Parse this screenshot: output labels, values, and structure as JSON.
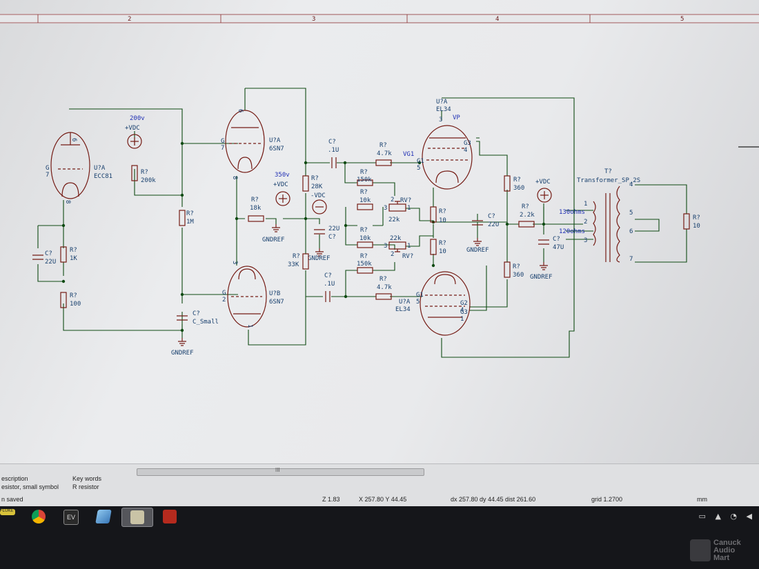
{
  "ruler": {
    "zones": [
      "2",
      "3",
      "4",
      "5"
    ]
  },
  "schematic": {
    "tubes": [
      {
        "ref": "U?A",
        "value": "ECC81",
        "pins": {
          "plate": "6",
          "grid": "G\n7",
          "cathode": "8"
        }
      },
      {
        "ref": "U?A",
        "value": "6SN7",
        "pins": {
          "plate": "6",
          "grid": "G\n7",
          "cathode": "8"
        }
      },
      {
        "ref": "U?B",
        "value": "6SN7",
        "pins": {
          "plate": "3",
          "grid": "G\n2",
          "cathode": "1"
        }
      },
      {
        "ref": "U?A",
        "value": "EL34",
        "pins": {
          "g1": "G1\n5",
          "g3": "G3\n4",
          "plate": "3"
        }
      },
      {
        "ref": "U?A",
        "value": "EL34",
        "pins": {
          "g1": "G1\n5",
          "g2": "G2\n4",
          "g3": "G3\n1"
        }
      }
    ],
    "labels": {
      "v200": "200v",
      "vdc1": "+VDC",
      "v350": "350v",
      "vdc2": "+VDC",
      "nvdc": "-VDC",
      "vdc3": "+VDC",
      "vg1": "VG1",
      "vp": "VP",
      "ohm130": "130ohms",
      "ohm120": "120ohms",
      "gnd1": "GNDREF",
      "gnd2": "GNDREF",
      "gnd3": "GNDREF",
      "gnd4": "GNDREF",
      "gnd5": "GNDREF",
      "transformer_ref": "T?",
      "transformer": "Transformer_SP_2S",
      "t_pins": [
        "1",
        "2",
        "3",
        "4",
        "5",
        "6",
        "7"
      ]
    },
    "components": [
      {
        "ref": "R?",
        "value": "200k"
      },
      {
        "ref": "R?",
        "value": "1M"
      },
      {
        "ref": "C?",
        "value": "C_Small"
      },
      {
        "ref": "C?",
        "value": "22U"
      },
      {
        "ref": "R?",
        "value": "1K"
      },
      {
        "ref": "R?",
        "value": "100"
      },
      {
        "ref": "R?",
        "value": "18k"
      },
      {
        "ref": "R?",
        "value": "28K"
      },
      {
        "ref": "R?",
        "value": "33K"
      },
      {
        "ref": "C?",
        "value": "22U"
      },
      {
        "ref": "C?",
        "value": ".1U"
      },
      {
        "ref": "C?",
        "value": ".1U"
      },
      {
        "ref": "R?",
        "value": "4.7k"
      },
      {
        "ref": "R?",
        "value": "150k"
      },
      {
        "ref": "R?",
        "value": "10k"
      },
      {
        "ref": "R?",
        "value": "10k"
      },
      {
        "ref": "R?",
        "value": "150k"
      },
      {
        "ref": "R?",
        "value": "4.7k"
      },
      {
        "ref": "RV?",
        "value": "22k"
      },
      {
        "ref": "RV?",
        "value": "22k"
      },
      {
        "ref": "R?",
        "value": "10"
      },
      {
        "ref": "R?",
        "value": "10"
      },
      {
        "ref": "C?",
        "value": "22U"
      },
      {
        "ref": "R?",
        "value": "360"
      },
      {
        "ref": "R?",
        "value": "360"
      },
      {
        "ref": "R?",
        "value": "2.2k"
      },
      {
        "ref": "C?",
        "value": "47U"
      },
      {
        "ref": "R?",
        "value": "10"
      }
    ],
    "pot_pins": [
      "2",
      "3",
      "1",
      "2",
      "3",
      "1"
    ]
  },
  "properties": {
    "description_label": "escription",
    "description_value": "esistor, small symbol",
    "keywords_label": "Key words",
    "keywords_value": "R resistor",
    "scroll_glyph": "III"
  },
  "status": {
    "message": "n saved",
    "zoom": "Z 1.83",
    "cursor": "X 257.80  Y 44.45",
    "delta": "dx 257.80  dy 44.45  dist 261.60",
    "grid": "grid 1.2700",
    "units": "mm"
  },
  "taskbar": {
    "apps": [
      {
        "name": "fluke",
        "label": "FLUKE",
        "color": "#d8c23a"
      },
      {
        "name": "chrome",
        "color": "#2e8b3c"
      },
      {
        "name": "ev",
        "label": "EV",
        "color": "#2a2a2a"
      },
      {
        "name": "blue-app",
        "color": "#4a88c8"
      },
      {
        "name": "kicad",
        "color": "#c9c3a6"
      },
      {
        "name": "acrobat",
        "color": "#b52a1e"
      }
    ]
  },
  "watermark": {
    "line1": "Canuck",
    "line2": "Audio",
    "line3": "Mart"
  }
}
